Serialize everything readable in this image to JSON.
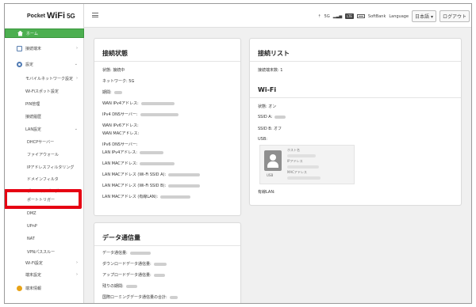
{
  "logo": {
    "pocket": "Pocket",
    "wifi": "WiFi",
    "g": "5G"
  },
  "sidebar": {
    "home": "ホーム",
    "devices": "接続端末",
    "settings": "設定",
    "mobile_network": "モバイルネットワーク設定",
    "wifi_spot": "Wi-Fiスポット設定",
    "pin": "PIN管理",
    "history": "接続履歴",
    "lan": "LAN設定",
    "dhcp": "DHCPサーバー",
    "firewall": "ファイアウォール",
    "ip_filter": "IPアドレスフィルタリング",
    "domain_filter": "ドメインフィルタ",
    "port_mapping": "ポートマッピング",
    "port_trigger": "ポートトリガー",
    "dmz": "DMZ",
    "upnp": "UPnP",
    "nat": "NAT",
    "vpn": "VPNパススルー",
    "wifi_settings": "Wi-Fi設定",
    "device_settings": "端末設定",
    "device_info": "端末情報"
  },
  "header": {
    "signal": "5G",
    "net": "5G",
    "chip": "LTE",
    "carrier": "SoftBank",
    "language_label": "Language",
    "language_value": "日本語",
    "logout": "ログアウト"
  },
  "connection_status": {
    "title": "接続状態",
    "status": "状態: 接続中",
    "network": "ネットワーク: 5G",
    "time": "期間:",
    "wan_ipv4": "WAN IPv4アドレス:",
    "ipv4_dns": "IPv4 DNSサーバー:",
    "wan_ipv6": "WAN IPv6アドレス:",
    "wan_mac": "WAN MACアドレス:",
    "ipv6_dns": "IPv6 DNSサーバー:",
    "lan_ipv4": "LAN IPv4アドレス:",
    "lan_mac": "LAN MACアドレス:",
    "lan_mac_a": "LAN MACアドレス (Wi-Fi SSID A):",
    "lan_mac_b": "LAN MACアドレス (Wi-Fi SSID B):",
    "lan_mac_wired": "LAN MACアドレス (有線LAN):"
  },
  "connection_list": {
    "title": "接続リスト",
    "count": "接続端末数: 1"
  },
  "wifi": {
    "title": "Wi-Fi",
    "status": "状態: オン",
    "ssid_a": "SSID A:",
    "ssid_b": "SSID B: オフ",
    "usb": "USB:",
    "usb_label": "USB",
    "host": "ホスト名",
    "ip": "IPアドレス",
    "mac": "MACアドレス",
    "wired": "有線LAN:"
  },
  "data_usage": {
    "title": "データ通信量",
    "data": "データ通信量:",
    "download": "ダウンロードデータ通信量:",
    "upload": "アップロードデータ通信量:",
    "remaining": "残りの期間:",
    "roaming": "国際ローミングデータ通信量の合計:"
  },
  "colors": {
    "accent": "#4caf50",
    "highlight": "#e60012"
  }
}
